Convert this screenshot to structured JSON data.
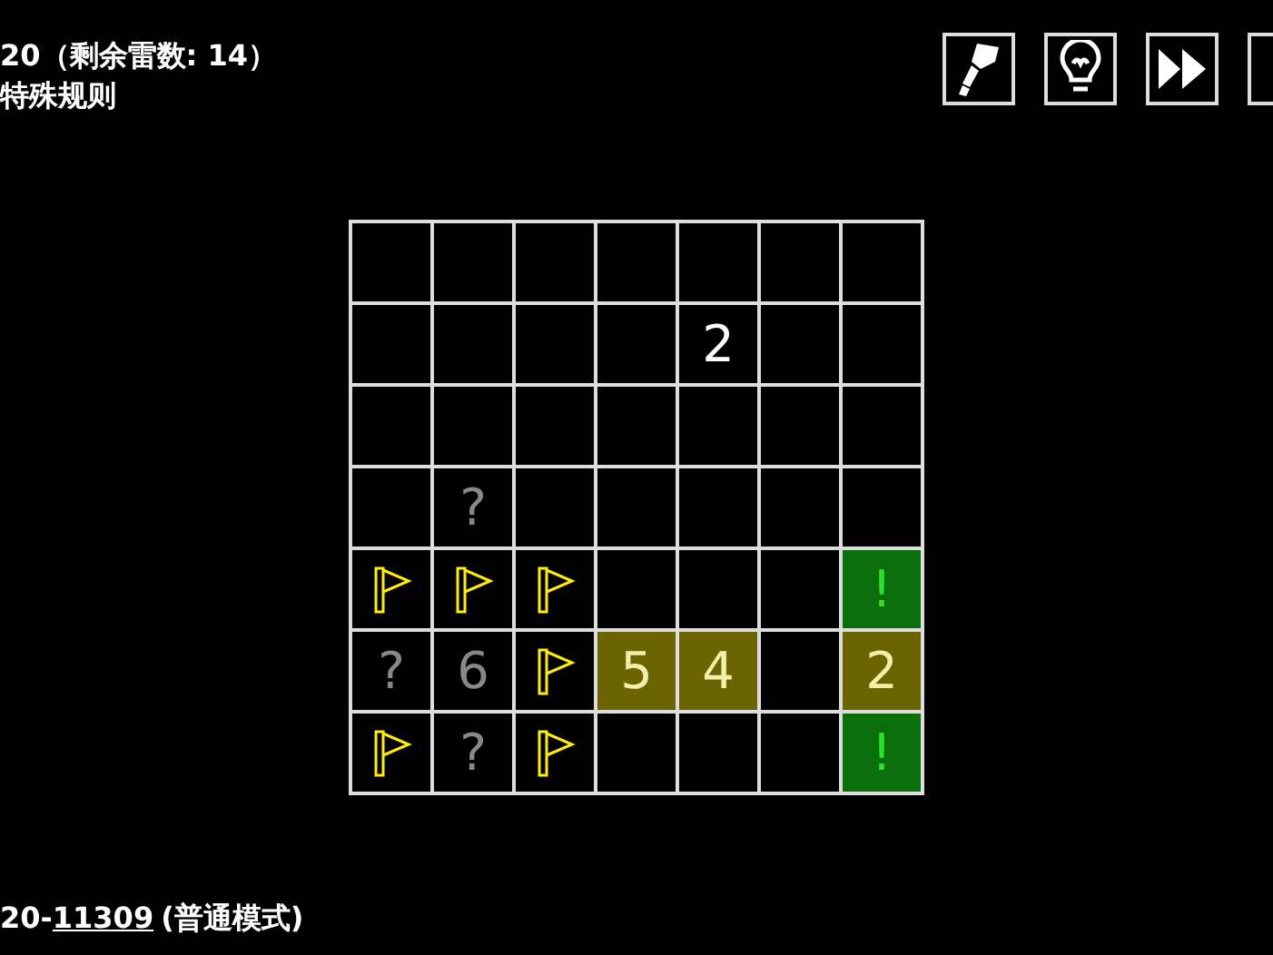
{
  "status": {
    "title": "20（剩余雷数: 14）",
    "subtitle": "特殊规则"
  },
  "toolbar": [
    {
      "kind": "brush"
    },
    {
      "kind": "bulb"
    },
    {
      "kind": "skip"
    },
    {
      "kind": "partial"
    }
  ],
  "board": {
    "rows": [
      [
        {
          "kind": "empty"
        },
        {
          "kind": "empty"
        },
        {
          "kind": "empty"
        },
        {
          "kind": "empty"
        },
        {
          "kind": "empty"
        },
        {
          "kind": "empty"
        },
        {
          "kind": "empty"
        }
      ],
      [
        {
          "kind": "empty"
        },
        {
          "kind": "empty"
        },
        {
          "kind": "empty"
        },
        {
          "kind": "empty"
        },
        {
          "kind": "clue",
          "text": "2"
        },
        {
          "kind": "empty"
        },
        {
          "kind": "empty"
        }
      ],
      [
        {
          "kind": "empty"
        },
        {
          "kind": "empty"
        },
        {
          "kind": "empty"
        },
        {
          "kind": "empty"
        },
        {
          "kind": "empty"
        },
        {
          "kind": "empty"
        },
        {
          "kind": "empty"
        }
      ],
      [
        {
          "kind": "empty"
        },
        {
          "kind": "dim",
          "text": "?"
        },
        {
          "kind": "empty"
        },
        {
          "kind": "empty"
        },
        {
          "kind": "empty"
        },
        {
          "kind": "empty"
        },
        {
          "kind": "empty"
        }
      ],
      [
        {
          "kind": "flag"
        },
        {
          "kind": "flag"
        },
        {
          "kind": "flag"
        },
        {
          "kind": "empty"
        },
        {
          "kind": "empty"
        },
        {
          "kind": "empty"
        },
        {
          "kind": "safe",
          "text": "!"
        }
      ],
      [
        {
          "kind": "dim",
          "text": "?"
        },
        {
          "kind": "dim",
          "text": "6"
        },
        {
          "kind": "flag"
        },
        {
          "kind": "highlight",
          "text": "5"
        },
        {
          "kind": "highlight",
          "text": "4"
        },
        {
          "kind": "empty"
        },
        {
          "kind": "highlight",
          "text": "2"
        }
      ],
      [
        {
          "kind": "flag"
        },
        {
          "kind": "dim",
          "text": "?"
        },
        {
          "kind": "flag"
        },
        {
          "kind": "empty"
        },
        {
          "kind": "empty"
        },
        {
          "kind": "empty"
        },
        {
          "kind": "safe",
          "text": "!"
        }
      ]
    ]
  },
  "footer": {
    "prefix": "20-",
    "link": "11309",
    "mode": "(普通模式)"
  }
}
